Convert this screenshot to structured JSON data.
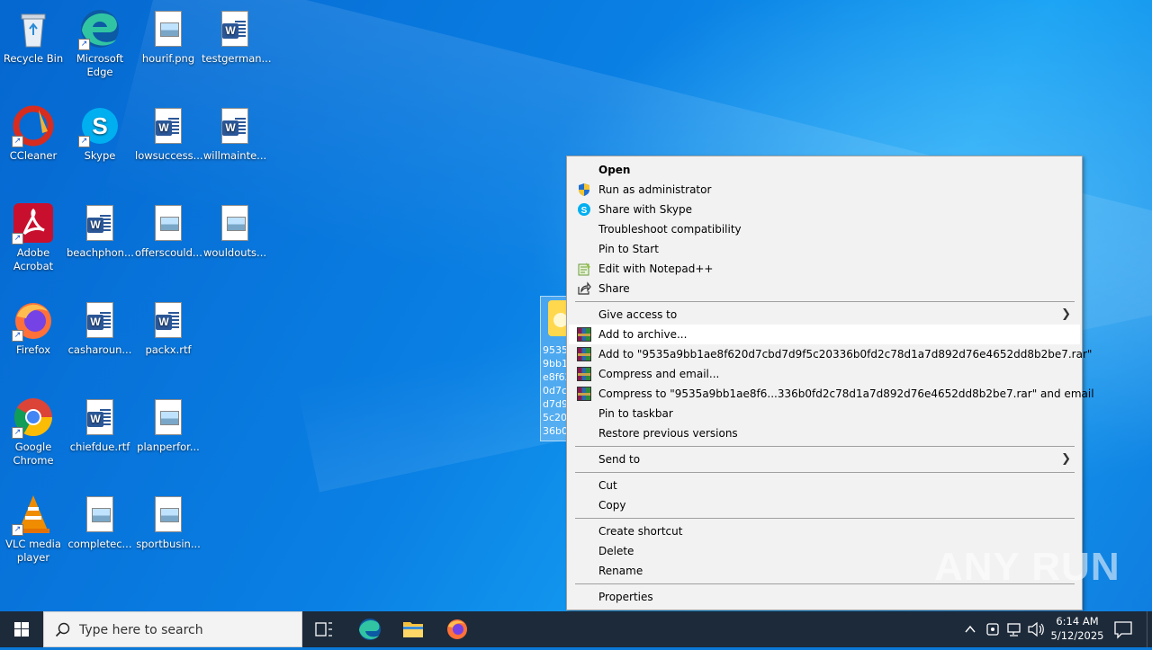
{
  "desktop": {
    "icons": [
      {
        "label": "Recycle Bin",
        "icon": "recycle-bin-icon"
      },
      {
        "label": "Microsoft Edge",
        "icon": "edge-icon"
      },
      {
        "label": "hourif.png",
        "icon": "image-file-icon"
      },
      {
        "label": "testgerman...",
        "icon": "word-doc-icon"
      },
      {
        "label": "CCleaner",
        "icon": "ccleaner-icon"
      },
      {
        "label": "Skype",
        "icon": "skype-icon"
      },
      {
        "label": "lowsuccess...",
        "icon": "word-doc-icon"
      },
      {
        "label": "willmainte...",
        "icon": "word-doc-icon"
      },
      {
        "label": "Adobe Acrobat",
        "icon": "acrobat-icon"
      },
      {
        "label": "beachphon...",
        "icon": "word-doc-icon"
      },
      {
        "label": "offerscould...",
        "icon": "image-file-icon"
      },
      {
        "label": "wouldouts...",
        "icon": "image-file-icon"
      },
      {
        "label": "Firefox",
        "icon": "firefox-icon"
      },
      {
        "label": "casharoun...",
        "icon": "word-doc-icon"
      },
      {
        "label": "packx.rtf",
        "icon": "word-doc-icon"
      },
      {
        "label": "Google Chrome",
        "icon": "chrome-icon"
      },
      {
        "label": "chiefdue.rtf",
        "icon": "word-doc-icon"
      },
      {
        "label": "planperfor...",
        "icon": "image-file-icon"
      },
      {
        "label": "VLC media player",
        "icon": "vlc-icon"
      },
      {
        "label": "completec...",
        "icon": "image-file-icon"
      },
      {
        "label": "sportbusin...",
        "icon": "image-file-icon"
      }
    ],
    "selected_file_label": "9535a9bb1ae8f620d7cbd7d9f5c20336b0fd2c78d1a7d892d76e4652dd8b2be7"
  },
  "context_menu": {
    "items": [
      {
        "label": "Open",
        "icon": ""
      },
      {
        "label": "Run as administrator",
        "icon": "uac-shield-icon"
      },
      {
        "label": "Share with Skype",
        "icon": "skype-icon"
      },
      {
        "label": "Troubleshoot compatibility",
        "icon": ""
      },
      {
        "label": "Pin to Start",
        "icon": ""
      },
      {
        "label": "Edit with Notepad++",
        "icon": "notepadpp-icon"
      },
      {
        "label": "Share",
        "icon": "share-icon"
      },
      {
        "label": "Give access to",
        "icon": ""
      },
      {
        "label": "Add to archive...",
        "icon": "winrar-icon"
      },
      {
        "label": "Add to \"9535a9bb1ae8f620d7cbd7d9f5c20336b0fd2c78d1a7d892d76e4652dd8b2be7.rar\"",
        "icon": "winrar-icon"
      },
      {
        "label": "Compress and email...",
        "icon": "winrar-icon"
      },
      {
        "label": "Compress to \"9535a9bb1ae8f6...336b0fd2c78d1a7d892d76e4652dd8b2be7.rar\" and email",
        "icon": "winrar-icon"
      },
      {
        "label": "Pin to taskbar",
        "icon": ""
      },
      {
        "label": "Restore previous versions",
        "icon": ""
      },
      {
        "label": "Send to",
        "icon": ""
      },
      {
        "label": "Cut",
        "icon": ""
      },
      {
        "label": "Copy",
        "icon": ""
      },
      {
        "label": "Create shortcut",
        "icon": ""
      },
      {
        "label": "Delete",
        "icon": ""
      },
      {
        "label": "Rename",
        "icon": ""
      },
      {
        "label": "Properties",
        "icon": ""
      }
    ],
    "highlighted": "Add to archive..."
  },
  "taskbar": {
    "search_placeholder": "Type here to search",
    "time": "6:14 AM",
    "date": "5/12/2025"
  },
  "watermark": "ANY RUN"
}
